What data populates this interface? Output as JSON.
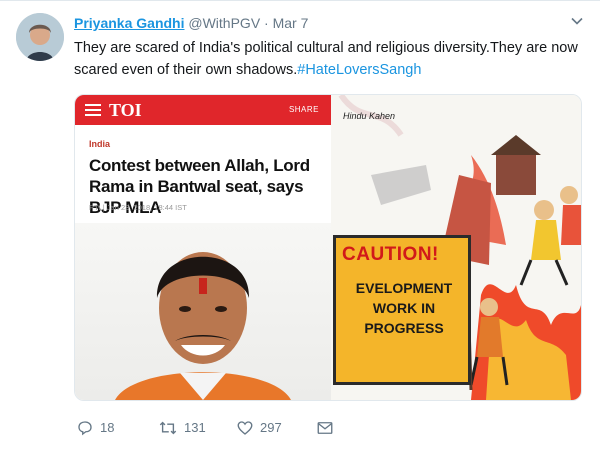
{
  "tweet": {
    "author_name": "Priyanka Gandhi",
    "handle": "@WithPGV",
    "separator": "·",
    "time": "Mar 7",
    "text": "They are scared of India's political cultural and religious diversity.They are now scared even of their own shadows.",
    "hashtag": "#HateLoversSangh"
  },
  "media": {
    "left": {
      "brand": "TOI",
      "share_label": "SHARE",
      "section": "India",
      "headline": "Contest between Allah, Lord Rama in Bantwal seat, says BJP MLA",
      "byline": "PTI | Jan 23, 2018, 18:44 IST"
    },
    "right": {
      "credit": "Hindu Kahen",
      "sign_title": "CAUTION!",
      "sign_lines": "EVELOPMENT WORK IN PROGRESS"
    }
  },
  "actions": {
    "reply_count": "18",
    "retweet_count": "131",
    "like_count": "297"
  },
  "colors": {
    "link": "#1b95e0",
    "muted": "#657786",
    "toi_red": "#e0262b",
    "sign_yellow": "#f4b52a"
  }
}
